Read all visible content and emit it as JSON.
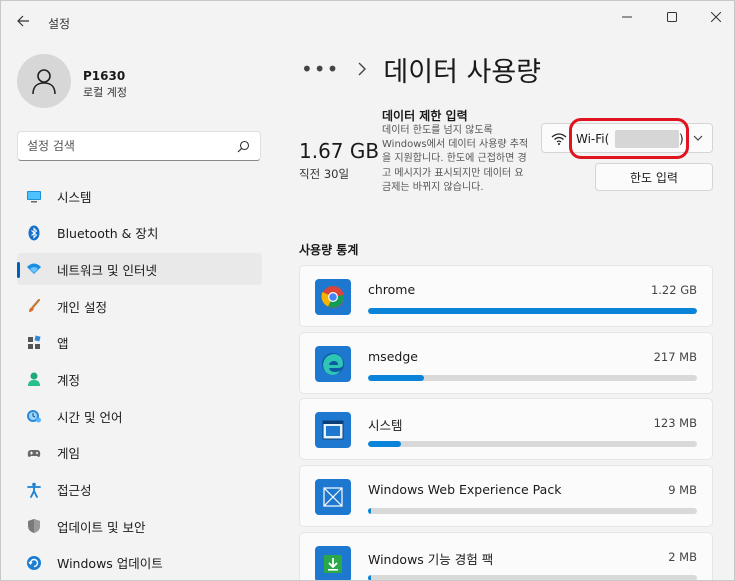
{
  "window": {
    "title": "설정"
  },
  "profile": {
    "name": "P1630",
    "account_type": "로컬 계정"
  },
  "search": {
    "placeholder": "설정 검색"
  },
  "nav": {
    "items": [
      {
        "label": "시스템",
        "icon": "system-icon",
        "active": false
      },
      {
        "label": "Bluetooth & 장치",
        "icon": "bluetooth-icon",
        "active": false
      },
      {
        "label": "네트워크 및 인터넷",
        "icon": "network-icon",
        "active": true
      },
      {
        "label": "개인 설정",
        "icon": "brush-icon",
        "active": false
      },
      {
        "label": "앱",
        "icon": "apps-icon",
        "active": false
      },
      {
        "label": "계정",
        "icon": "accounts-icon",
        "active": false
      },
      {
        "label": "시간 및 언어",
        "icon": "time-language-icon",
        "active": false
      },
      {
        "label": "게임",
        "icon": "gaming-icon",
        "active": false
      },
      {
        "label": "접근성",
        "icon": "accessibility-icon",
        "active": false
      },
      {
        "label": "업데이트 및 보안",
        "icon": "shield-icon",
        "active": false
      },
      {
        "label": "Windows 업데이트",
        "icon": "windows-update-icon",
        "active": false
      }
    ]
  },
  "breadcrumb": {
    "dots": "•••",
    "title": "데이터 사용량"
  },
  "summary": {
    "total": "1.67 GB",
    "period": "직전 30일"
  },
  "data_limit": {
    "title": "데이터 제한 입력",
    "description": "데이터 한도를 넘지 않도록 Windows에서 데이터 사용량 추적을 지원합니다. 한도에 근접하면 경고 메시지가 표시되지만 데이터 요금제는 바뀌지 않습니다.",
    "network_label": "Wi-Fi(",
    "network_label_end": ")",
    "button_label": "한도 입력"
  },
  "usage": {
    "title": "사용량 통계",
    "apps": [
      {
        "name": "chrome",
        "size": "1.22 GB",
        "fraction": 1.0,
        "icon": "chrome-icon"
      },
      {
        "name": "msedge",
        "size": "217 MB",
        "fraction": 0.17,
        "icon": "edge-icon"
      },
      {
        "name": "시스템",
        "size": "123 MB",
        "fraction": 0.1,
        "icon": "system-app-icon"
      },
      {
        "name": "Windows Web Experience Pack",
        "size": "9 MB",
        "fraction": 0.008,
        "icon": "web-experience-icon"
      },
      {
        "name": "Windows 기능 경험 팩",
        "size": "2 MB",
        "fraction": 0.003,
        "icon": "feature-pack-icon"
      }
    ]
  },
  "colors": {
    "accent": "#005fb8",
    "bar": "#0a84d8",
    "highlight": "#e0141e"
  }
}
